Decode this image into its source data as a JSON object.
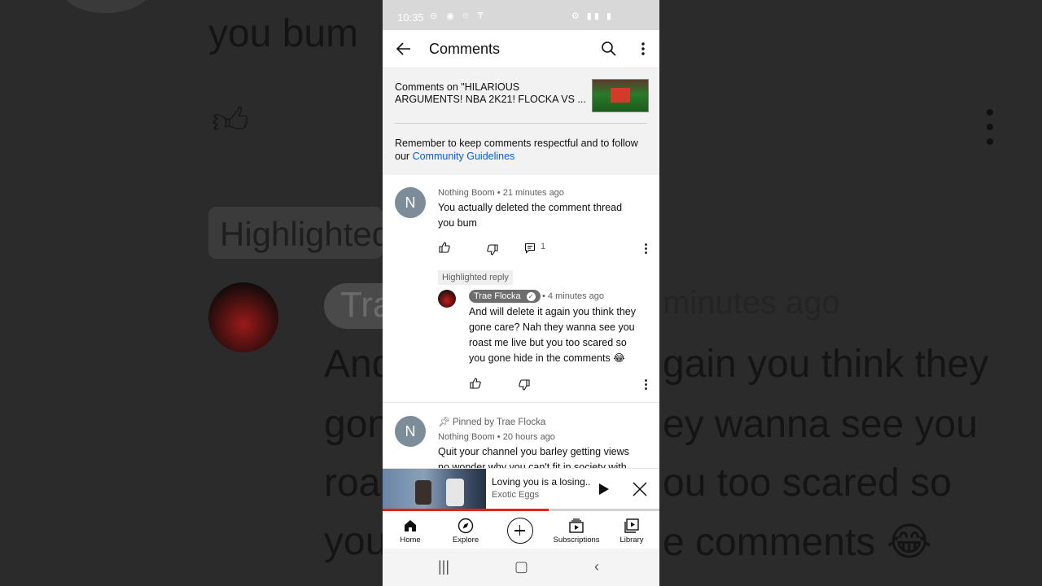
{
  "status_bar": {
    "time": "10:35",
    "left_icons": "⊖ ◉ ⌾ ₸",
    "right_icons": "⚙ ▮▮ ▮"
  },
  "app_bar": {
    "title": "Comments",
    "back_icon": "arrow-left-icon",
    "search_icon": "search-icon",
    "more_icon": "more-vertical-icon"
  },
  "header": {
    "comments_on": "Comments on \"HILARIOUS ARGUMENTS! NBA 2K21! FLOCKA VS ...",
    "reminder": "Remember to keep comments respectful and to follow our",
    "guidelines_link": "Community Guidelines"
  },
  "comments": [
    {
      "avatar_letter": "N",
      "author": "Nothing Boom",
      "time": "21 minutes ago",
      "text_line1": "You actually deleted the comment thread",
      "text_line2": "you bum",
      "reply_count": "1"
    }
  ],
  "reply": {
    "tag": "Highlighted reply",
    "author": "Trae Flocka",
    "time": "4 minutes ago",
    "text_line1": "And will delete it again you think they",
    "text_line2": "gone care? Nah they wanna see you",
    "text_line3": "roast me live but you too scared so",
    "text_line4": "you gone hide in the comments 😂"
  },
  "pinned_comment": {
    "pinned_label": "Pinned by Trae Flocka",
    "avatar_letter": "N",
    "author": "Nothing Boom",
    "time": "20 hours ago",
    "text_line1": "Quit your channel you barley getting views",
    "text_line2": "no wonder why you can't fit in society with"
  },
  "miniplayer": {
    "title": "Loving you is a losing..",
    "channel": "Exotic Eggs",
    "progress": 0.6
  },
  "bottom_nav": {
    "home": "Home",
    "explore": "Explore",
    "subscriptions": "Subscriptions",
    "library": "Library"
  },
  "background": {
    "text_you_bum": "you bum",
    "text_highlighted": "Highlighted",
    "text_trae": "Tra",
    "text_minutes": "minutes ago",
    "line1_left": "And",
    "line1_right": "gain you think they",
    "line2_left": "gon",
    "line2_right": "ey wanna see you",
    "line3_left": "roa",
    "line3_right": "ou too scared so",
    "line4_left": "you",
    "line4_right": "e comments 😂"
  },
  "colors": {
    "accent_link": "#065fd4",
    "progress_red": "#e62117",
    "avatar_gray": "#7d8c99"
  }
}
